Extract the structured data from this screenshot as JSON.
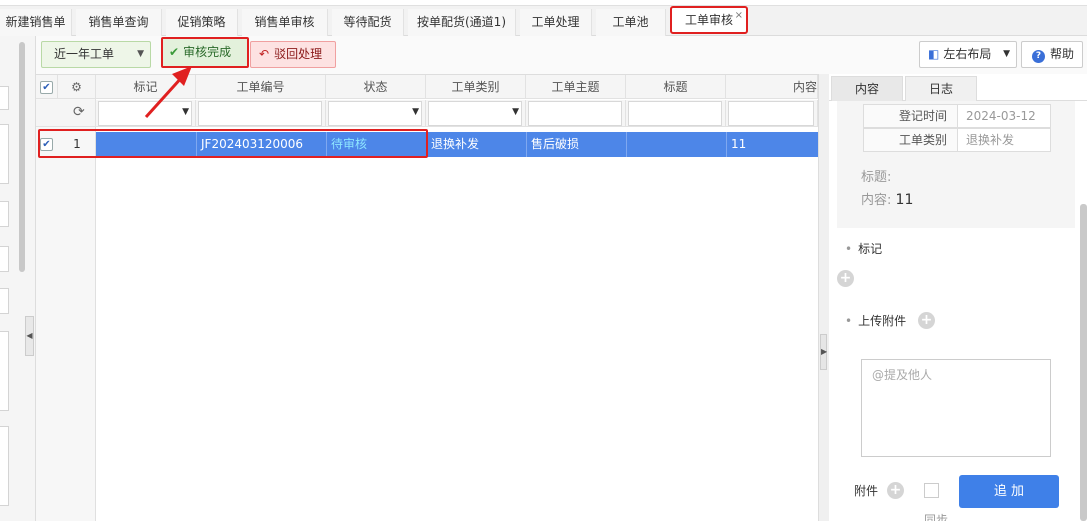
{
  "tabs": [
    {
      "label": "新建销售单"
    },
    {
      "label": "销售单查询"
    },
    {
      "label": "促销策略"
    },
    {
      "label": "销售单审核"
    },
    {
      "label": "等待配货"
    },
    {
      "label": "按单配货(通道1)"
    },
    {
      "label": "工单处理"
    },
    {
      "label": "工单池"
    },
    {
      "label": "工单审核",
      "close": "×"
    }
  ],
  "toolbar": {
    "range_select": "近一年工单",
    "approve_label": "审核完成",
    "reject_label": "驳回处理",
    "layout_label": "左右布局",
    "help_label": "帮助"
  },
  "grid": {
    "columns": [
      "标记",
      "工单编号",
      "状态",
      "工单类别",
      "工单主题",
      "标题",
      "内容"
    ],
    "rows": [
      {
        "index": "1",
        "mark": "",
        "ticket_no": "JF202403120006",
        "status": "待审核",
        "category": "退换补发",
        "subject": "售后破损",
        "title": "",
        "content": "11"
      }
    ]
  },
  "detail": {
    "tabs": [
      "内容",
      "日志"
    ],
    "reg_time_label": "登记时间",
    "reg_time_value": "2024-03-12",
    "category_label": "工单类别",
    "category_value": "退换补发",
    "title_label": "标题:",
    "title_value": "",
    "content_label": "内容:",
    "content_value": "11",
    "mark_label": "标记",
    "upload_label": "上传附件",
    "mention_placeholder": "@提及他人",
    "attach_label": "附件",
    "sync_label": "同步",
    "add_label": "追 加"
  },
  "colors": {
    "selected_row": "#4d86e8",
    "highlight": "#e02020",
    "primary": "#3f80e8",
    "status_pending": "#8ee6ff"
  }
}
